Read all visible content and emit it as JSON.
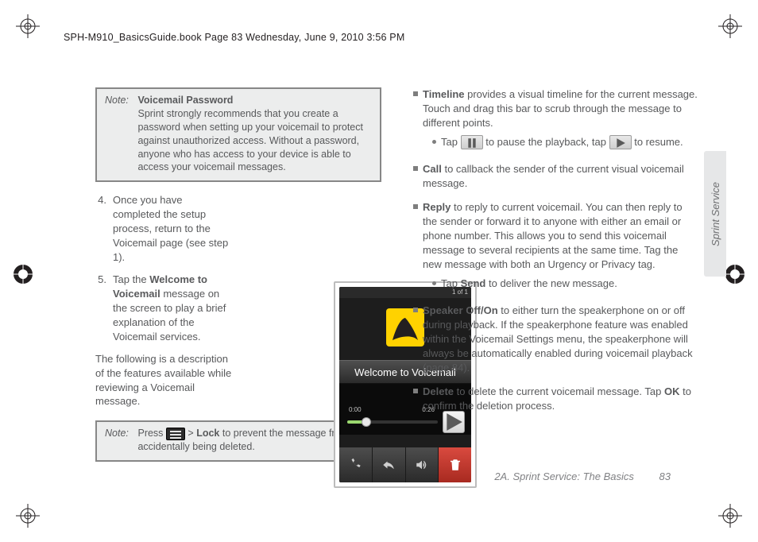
{
  "header": "SPH-M910_BasicsGuide.book  Page 83  Wednesday, June 9, 2010  3:56 PM",
  "note1": {
    "label": "Note:",
    "title": "Voicemail Password",
    "body": "Sprint strongly recommends that you create a password when setting up your voicemail to protect against unauthorized access. Without a password, anyone who has access to your device is able to access your voicemail messages."
  },
  "steps": {
    "s4num": "4.",
    "s4": "Once you have completed the setup process, return to the Voicemail page (see step 1).",
    "s5num": "5.",
    "s5a": "Tap the ",
    "s5bold": "Welcome to Voicemail",
    "s5b": " message on the screen to play a brief explanation of the Voicemail services."
  },
  "interlude": "The following is a description of the features available while reviewing a Voicemail message.",
  "note2": {
    "label": "Note:",
    "a": "Press ",
    "b": " > ",
    "lock": "Lock",
    "c": " to prevent the message from accidentally being deleted."
  },
  "phone": {
    "statusRight": "1 of 1",
    "title": "Welcome to Voicemail",
    "t0": "0:00",
    "t1": "0:26"
  },
  "right": {
    "timeline_bold": "Timeline",
    "timeline": " provides a visual timeline for the current message. Touch and drag this bar to scrub through the message to different points.",
    "timeline_sub_a": "Tap ",
    "timeline_sub_b": " to pause the playback, tap ",
    "timeline_sub_c": " to resume.",
    "call_bold": "Call",
    "call": " to callback the sender of the current visual voicemail message.",
    "reply_bold": "Reply",
    "reply": " to reply to current voicemail. You can then reply to the sender or forward it to anyone with either an email or phone number. This allows you to send this voicemail message to several recipients at the same time. Tag the new message with both an Urgency or Privacy tag.",
    "reply_sub_a": "Tap ",
    "reply_sub_bold": "Send",
    "reply_sub_b": " to deliver the new message.",
    "spk_bold": "Speaker Off/On",
    "spk": " to either turn the speakerphone on or off during playback. If the speakerphone feature was enabled within the Voicemail Settings menu, the speakerphone will always be automatically enabled during voicemail playback (page 84).",
    "del_bold": "Delete",
    "del_a": " to delete the current voicemail message. Tap ",
    "del_ok": "OK",
    "del_b": " to confirm the deletion process."
  },
  "sideTab": "Sprint Service",
  "footer": {
    "text": "2A. Sprint Service: The Basics",
    "page": "83"
  }
}
